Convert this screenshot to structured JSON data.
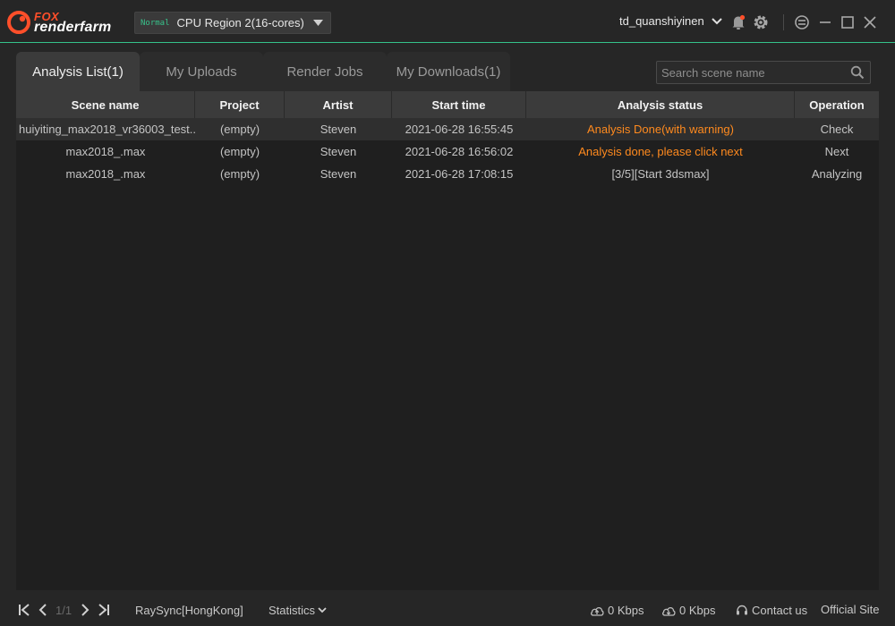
{
  "app": {
    "brand_top": "FOX",
    "brand_bottom": "renderfarm"
  },
  "header": {
    "region_badge": "Normal",
    "region_label": "CPU Region 2(16-cores)",
    "username": "td_quanshiyinen"
  },
  "tabs": [
    {
      "label": "Analysis List(1)",
      "active": true
    },
    {
      "label": "My Uploads",
      "active": false
    },
    {
      "label": "Render Jobs",
      "active": false
    },
    {
      "label": "My Downloads(1)",
      "active": false
    }
  ],
  "search": {
    "placeholder": "Search scene name",
    "value": ""
  },
  "table": {
    "columns": [
      "Scene name",
      "Project",
      "Artist",
      "Start time",
      "Analysis status",
      "Operation"
    ],
    "rows": [
      {
        "scene": "huiyiting_max2018_vr36003_test...",
        "project": "(empty)",
        "artist": "Steven",
        "start": "2021-06-28 16:55:45",
        "status": "Analysis Done(with warning)",
        "operation": "Check"
      },
      {
        "scene": "max2018_.max",
        "project": "(empty)",
        "artist": "Steven",
        "start": "2021-06-28 16:56:02",
        "status": "Analysis done, please click next",
        "operation": "Next"
      },
      {
        "scene": "max2018_.max",
        "project": "(empty)",
        "artist": "Steven",
        "start": "2021-06-28 17:08:15",
        "status": "[3/5][Start 3dsmax]",
        "operation": "Analyzing"
      }
    ]
  },
  "footer": {
    "page": "1/1",
    "transfer": "RaySync[HongKong]",
    "statistics": "Statistics",
    "upload_speed": "0 Kbps",
    "download_speed": "0 Kbps",
    "contact": "Contact us",
    "site": "Official Site"
  },
  "colors": {
    "accent": "#35c28a",
    "warning": "#ff8a1e",
    "brand": "#ff4f2a"
  }
}
